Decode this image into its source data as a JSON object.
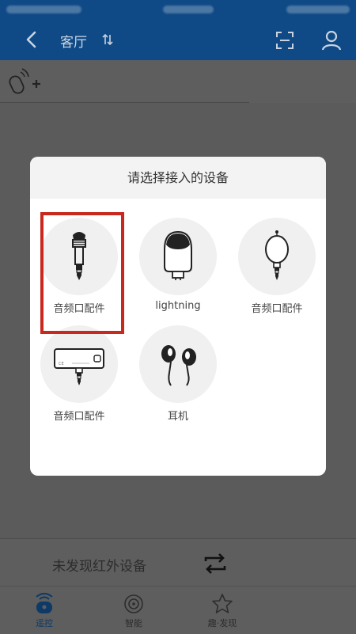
{
  "navbar": {
    "title": "客厅",
    "icons": [
      "back-icon",
      "swap-icon",
      "scan-icon",
      "user-icon"
    ]
  },
  "subbar": {
    "icons": [
      "add-remote-icon"
    ]
  },
  "dialog": {
    "title": "请选择接入的设备",
    "devices": [
      {
        "label": "音频口配件",
        "icon": "audio-jack-icon"
      },
      {
        "label": "lightning",
        "icon": "lightning-adapter-icon"
      },
      {
        "label": "音频口配件",
        "icon": "bulb-jack-icon"
      },
      {
        "label": "音频口配件",
        "icon": "card-adapter-icon"
      },
      {
        "label": "耳机",
        "icon": "earphones-icon"
      }
    ]
  },
  "bottom": {
    "message": "未发现红外设备",
    "refresh_icon": "refresh-icon"
  },
  "tabs": [
    {
      "label": "遥控",
      "icon": "remote-tab-icon",
      "active": true
    },
    {
      "label": "智能",
      "icon": "smart-tab-icon",
      "active": false
    },
    {
      "label": "趣·发现",
      "icon": "discover-tab-icon",
      "active": false
    }
  ],
  "colors": {
    "nav_bg": "#0f4a86",
    "highlight": "#c8281e",
    "overlay": "#5b5b5b"
  }
}
